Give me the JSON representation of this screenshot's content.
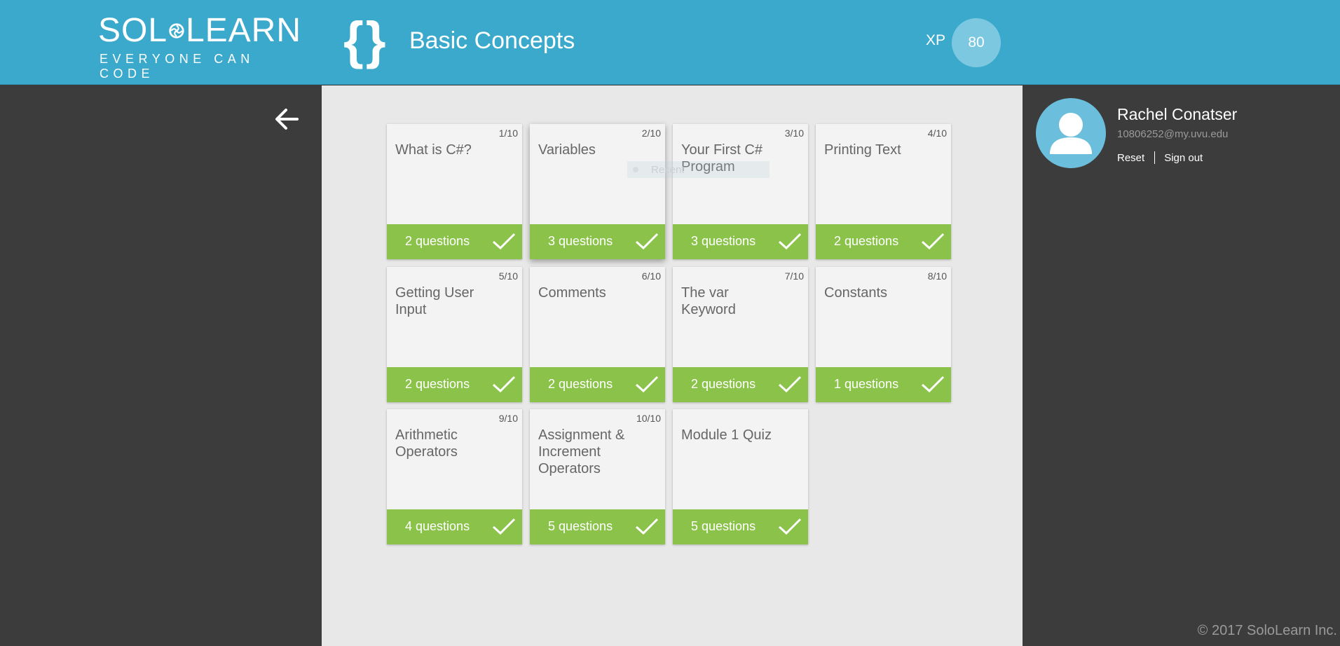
{
  "header": {
    "logo": {
      "wordmark_left": "SOL",
      "wordmark_right": "LEARN",
      "tagline": "EVERYONE CAN CODE"
    },
    "braces": "{}",
    "title": "Basic Concepts",
    "xp_label": "XP",
    "xp_value": "80"
  },
  "lessons": [
    {
      "num": "1/10",
      "title": "What is C#?",
      "questions": "2 questions"
    },
    {
      "num": "2/10",
      "title": "Variables",
      "questions": "3 questions"
    },
    {
      "num": "3/10",
      "title": "Your First C# Program",
      "questions": "3 questions"
    },
    {
      "num": "4/10",
      "title": "Printing Text",
      "questions": "2 questions"
    },
    {
      "num": "5/10",
      "title": "Getting User Input",
      "questions": "2 questions"
    },
    {
      "num": "6/10",
      "title": "Comments",
      "questions": "2 questions"
    },
    {
      "num": "7/10",
      "title": "The var Keyword",
      "questions": "2 questions"
    },
    {
      "num": "8/10",
      "title": "Constants",
      "questions": "1 questions"
    },
    {
      "num": "9/10",
      "title": "Arithmetic Operators",
      "questions": "4 questions"
    },
    {
      "num": "10/10",
      "title": "Assignment & Increment Operators",
      "questions": "5 questions"
    },
    {
      "num": "",
      "title": "Module 1 Quiz",
      "questions": "5 questions"
    }
  ],
  "ghost_tooltip": "Recent",
  "user": {
    "name": "Rachel Conatser",
    "email": "10806252@my.uvu.edu",
    "reset_label": "Reset",
    "signout_label": "Sign out"
  },
  "footer": {
    "copyright": "© 2017 SoloLearn Inc."
  },
  "colors": {
    "header": "#3aa9cc",
    "completed": "#8bc34a",
    "sidebar": "#3c3c3c",
    "content": "#e8e8e8"
  },
  "icons": {
    "back": "arrow-left-icon",
    "check": "checkmark-icon",
    "avatar": "user-silhouette-icon",
    "logo": "swirl-icon"
  }
}
